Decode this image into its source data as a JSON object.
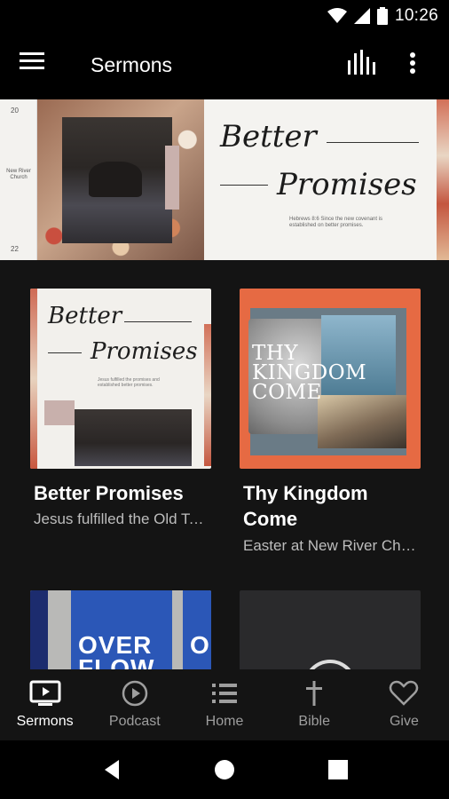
{
  "status_bar": {
    "time": "10:26"
  },
  "app_bar": {
    "title": "Sermons",
    "menu_icon": "menu-icon",
    "equalizer_icon": "equalizer-icon",
    "more_icon": "more-vert-icon"
  },
  "hero": {
    "title_line_1": "Better",
    "title_line_2": "Promises",
    "side_top": "20",
    "side_bottom": "22",
    "side_church": "New River Church",
    "small_text": "Hebrews 8:6 Since the new covenant is established on better promises."
  },
  "cards": [
    {
      "title": "Better Promises",
      "subtitle": "Jesus fulfilled the Old Testament",
      "art": {
        "line_1": "Better",
        "line_2": "Promises",
        "small_text": "Jesus fulfilled the promises and established better promises."
      }
    },
    {
      "title": "Thy Kingdom Come",
      "subtitle": "Easter at New River Church",
      "art": {
        "text": "THY KINGDOM COME"
      }
    },
    {
      "title": "",
      "subtitle": "",
      "art": {
        "line_1": "OVER",
        "line_2": "FLOW",
        "fragment": "O"
      }
    },
    {
      "title": "",
      "subtitle": ""
    }
  ],
  "bottom_nav": [
    {
      "label": "Sermons",
      "icon": "tv-play-icon",
      "active": true
    },
    {
      "label": "Podcast",
      "icon": "play-circle-icon",
      "active": false
    },
    {
      "label": "Home",
      "icon": "list-icon",
      "active": false
    },
    {
      "label": "Bible",
      "icon": "cross-icon",
      "active": false
    },
    {
      "label": "Give",
      "icon": "heart-icon",
      "active": false
    }
  ],
  "colors": {
    "background": "#141414",
    "bar": "#000000",
    "active_nav": "#ffffff",
    "inactive_nav": "#9e9e9e"
  }
}
